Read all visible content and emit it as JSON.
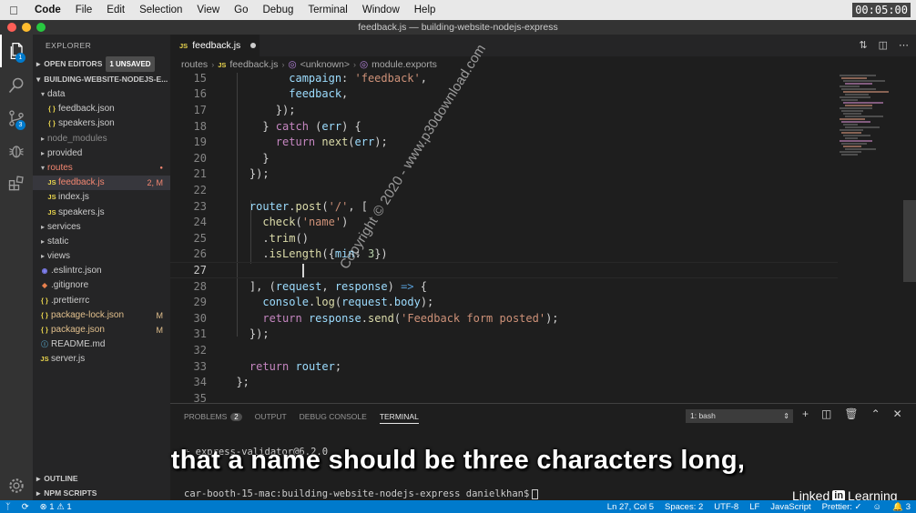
{
  "menubar": {
    "items": [
      "Code",
      "File",
      "Edit",
      "Selection",
      "View",
      "Go",
      "Debug",
      "Terminal",
      "Window",
      "Help"
    ],
    "clock": "00:05:00"
  },
  "window": {
    "title": "feedback.js — building-website-nodejs-express"
  },
  "activity": {
    "explorer_badge": "1",
    "scm_badge": "3"
  },
  "sidebar": {
    "title": "EXPLORER",
    "open_editors": "OPEN EDITORS",
    "unsaved": "1 UNSAVED",
    "project": "BUILDING-WEBSITE-NODEJS-E...",
    "tree": [
      {
        "label": "data",
        "type": "folder-open",
        "indent": 1
      },
      {
        "label": "feedback.json",
        "type": "json",
        "indent": 2
      },
      {
        "label": "speakers.json",
        "type": "json",
        "indent": 2
      },
      {
        "label": "node_modules",
        "type": "folder",
        "indent": 1,
        "dim": true
      },
      {
        "label": "provided",
        "type": "folder",
        "indent": 1
      },
      {
        "label": "routes",
        "type": "folder-open",
        "indent": 1,
        "error": true
      },
      {
        "label": "feedback.js",
        "type": "js",
        "indent": 2,
        "status": "2, M",
        "error": true,
        "selected": true
      },
      {
        "label": "index.js",
        "type": "js",
        "indent": 2
      },
      {
        "label": "speakers.js",
        "type": "js",
        "indent": 2
      },
      {
        "label": "services",
        "type": "folder",
        "indent": 1
      },
      {
        "label": "static",
        "type": "folder",
        "indent": 1
      },
      {
        "label": "views",
        "type": "folder",
        "indent": 1
      },
      {
        "label": ".eslintrc.json",
        "type": "eslint",
        "indent": 1
      },
      {
        "label": ".gitignore",
        "type": "git",
        "indent": 1
      },
      {
        "label": ".prettierrc",
        "type": "rc",
        "indent": 1
      },
      {
        "label": "package-lock.json",
        "type": "json",
        "indent": 1,
        "status": "M",
        "modified": true
      },
      {
        "label": "package.json",
        "type": "json",
        "indent": 1,
        "status": "M",
        "modified": true
      },
      {
        "label": "README.md",
        "type": "md",
        "indent": 1
      },
      {
        "label": "server.js",
        "type": "js",
        "indent": 1
      }
    ],
    "outline": "OUTLINE",
    "npm_scripts": "NPM SCRIPTS"
  },
  "editor": {
    "tab_label": "feedback.js",
    "breadcrumb": [
      "routes",
      "feedback.js",
      "<unknown>",
      "module.exports"
    ],
    "watermark": "Copyright © 2020 - www.p30download.com",
    "current_line": "27"
  },
  "panel": {
    "tabs": [
      {
        "label": "PROBLEMS",
        "count": "2"
      },
      {
        "label": "OUTPUT"
      },
      {
        "label": "DEBUG CONSOLE"
      },
      {
        "label": "TERMINAL",
        "active": true
      }
    ],
    "terminal_select": "1: bash",
    "terminal_lines": [
      "+ express-validator@6.2.0"
    ],
    "prompt": "car-booth-15-mac:building-website-nodejs-express danielkhan$"
  },
  "caption": "that a name should be three characters long,",
  "watermark_brand": {
    "linked": "Linked",
    "in": "in",
    "learning": "Learning"
  },
  "statusbar": {
    "errors": "1",
    "warnings": "1",
    "position": "Ln 27, Col 5",
    "spaces": "Spaces: 2",
    "encoding": "UTF-8",
    "eol": "LF",
    "language": "JavaScript",
    "prettier": "Prettier: ✓",
    "notifications": "3"
  },
  "colors": {
    "accent": "#007acc",
    "editor_bg": "#1e1e1e",
    "sidebar_bg": "#252526"
  }
}
